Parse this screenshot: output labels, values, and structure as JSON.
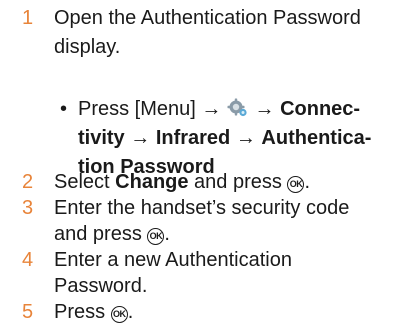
{
  "steps": [
    {
      "num": "1",
      "line1": "Open the Authentication Password",
      "line2": "display."
    },
    {
      "num": "2",
      "pre": "Select ",
      "bold": "Change",
      "post": " and press ",
      "key": "OK",
      "end": "."
    },
    {
      "num": "3",
      "line1": "Enter the handset’s security code",
      "line2_pre": "and press ",
      "key": "OK",
      "line2_end": "."
    },
    {
      "num": "4",
      "line1": "Enter a new Authentication",
      "line2": "Password."
    },
    {
      "num": "5",
      "pre": "Press ",
      "key": "OK",
      "end": "."
    }
  ],
  "bullet": {
    "dot": "•",
    "press": "Press [Menu] →",
    "arrow": "→",
    "line1_bold": "Connec-",
    "line2_bold_a": "tivity",
    "line2_bold_b": "Infrared",
    "line2_bold_c": "Authentica-",
    "line3_bold": "tion Password",
    "icon": "settings-gear-icon"
  },
  "colors": {
    "step_number": "#e8843a",
    "text": "#1a1a1a"
  }
}
